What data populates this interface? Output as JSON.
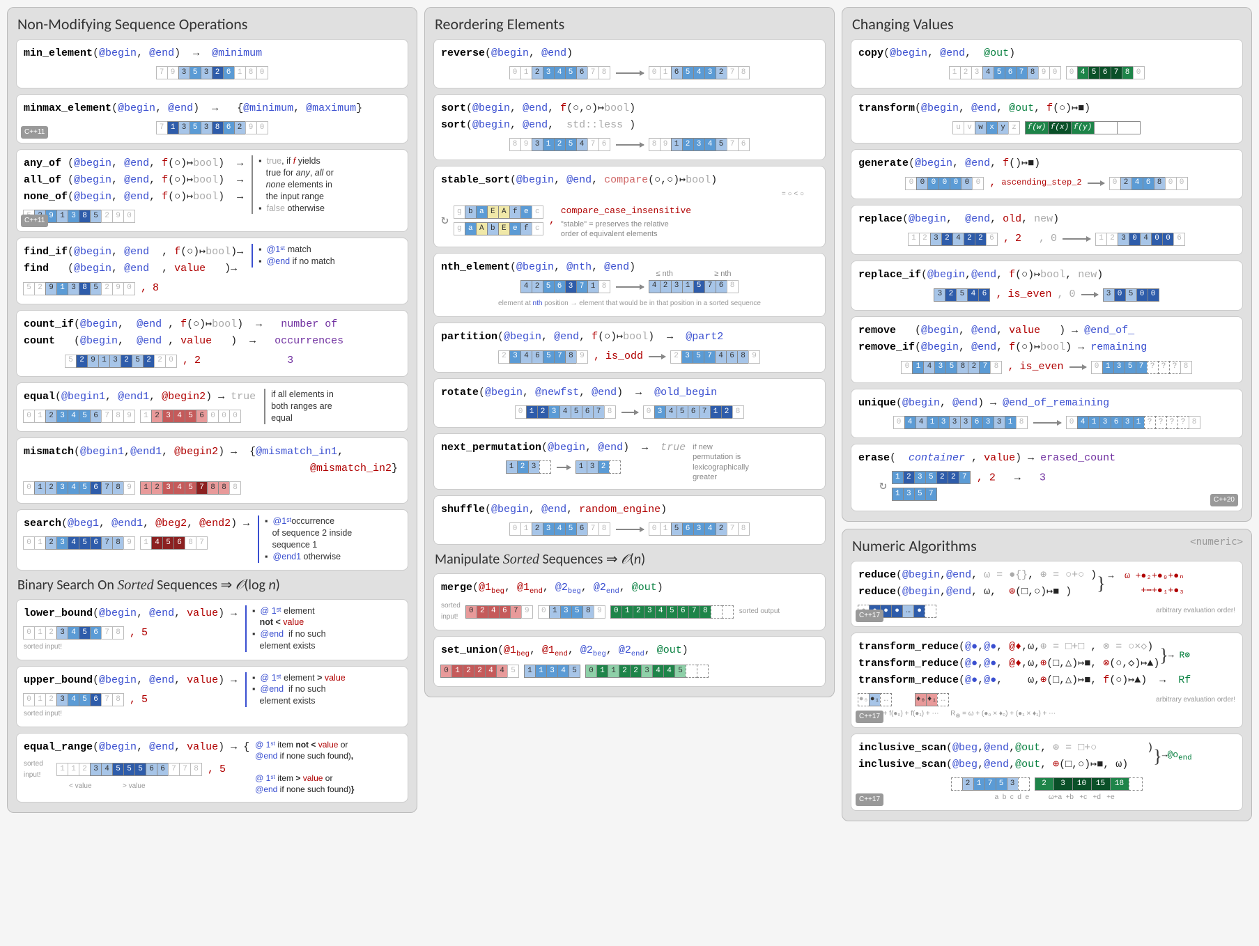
{
  "col1": {
    "title": "Non-Modifying Sequence Operations",
    "min_element": {
      "fn": "min_element",
      "sig": "(@begin, @end)  →  @minimum",
      "seq": [
        "7",
        "9",
        "3",
        "5",
        "3",
        "2",
        "6",
        "1",
        "8",
        "0"
      ]
    },
    "minmax_element": {
      "fn": "minmax_element",
      "sig": "(@begin, @end)  →",
      "ret": "{@minimum, @maximum}",
      "badge": "C++11",
      "seq": [
        "7",
        "1",
        "3",
        "5",
        "3",
        "8",
        "6",
        "2",
        "9",
        "0"
      ]
    },
    "any_all_none": {
      "lines": [
        {
          "fn": "any_of ",
          "sig": "(@begin, @end, f(○)↦bool)  →"
        },
        {
          "fn": "all_of ",
          "sig": "(@begin, @end, f(○)↦bool)  →"
        },
        {
          "fn": "none_of",
          "sig": "(@begin, @end, f(○)↦bool)  →"
        }
      ],
      "badge": "C++11",
      "desc": "▪  true, if f yields\n   true for any, all or\n   none elements in\n   the input range\n▪  false otherwise",
      "seq": [
        "5",
        "2",
        "9",
        "1",
        "3",
        "8",
        "5",
        "2",
        "9",
        "0"
      ]
    },
    "find": {
      "lines": [
        {
          "fn": "find_if",
          "sig": "(@begin, @end  , f(○)↦bool)→"
        },
        {
          "fn": "find   ",
          "sig": "(@begin, @end  , value   )→"
        }
      ],
      "desc": "▪  @1ˢᵗ match\n▪  @end if no match",
      "seq": [
        "5",
        "2",
        "9",
        "1",
        "3",
        "8",
        "5",
        "2",
        "9",
        "0"
      ],
      "val_ex": "8"
    },
    "count": {
      "lines": [
        {
          "fn": "count_if",
          "sig": "(@begin,  @end , f(○)↦bool)  →"
        },
        {
          "fn": "count   ",
          "sig": "(@begin,  @end , value   )  →"
        }
      ],
      "ret": "number of\noccurrences",
      "seq": [
        "5",
        "2",
        "9",
        "1",
        "3",
        "2",
        "5",
        "2",
        "2",
        "0"
      ],
      "val_ex": "2",
      "out_ex": "3"
    },
    "equal": {
      "fn": "equal",
      "sig": "(@begin1, @end1, @begin2) → true",
      "desc": "if all elements in\nboth ranges are\nequal",
      "seq1": [
        "0",
        "1",
        "2",
        "3",
        "4",
        "5",
        "6",
        "7",
        "8",
        "9"
      ],
      "seq2": [
        "1",
        "2",
        "3",
        "4",
        "5",
        "6",
        "0",
        "0",
        "0"
      ]
    },
    "mismatch": {
      "fn": "mismatch",
      "sig": "(@begin1,@end1, @begin2) →",
      "ret": "{@mismatch_in1,\n @mismatch_in2}",
      "seq1": [
        "0",
        "1",
        "2",
        "3",
        "4",
        "5",
        "6",
        "7",
        "8",
        "9"
      ],
      "seq2": [
        "1",
        "2",
        "3",
        "4",
        "5",
        "7",
        "8",
        "8",
        "8"
      ]
    },
    "search": {
      "fn": "search",
      "sig": "(@beg1, @end1, @beg2, @end2) →",
      "desc": "▪  @1ˢᵗoccurrence\n   of sequence 2 inside\n   sequence 1\n▪  @end1 otherwise",
      "seq1": [
        "0",
        "1",
        "2",
        "3",
        "4",
        "5",
        "6",
        "7",
        "8",
        "9"
      ],
      "seq2": [
        "1",
        "4",
        "5",
        "6",
        "8",
        "7"
      ]
    },
    "bsearch_title": "Binary Search On Sorted Sequences ⇒ 𝒪(log n)",
    "lower_bound": {
      "fn": "lower_bound",
      "sig": "(@begin, @end, value) →",
      "val_ex": "5",
      "desc": "▪  @ 1ˢᵗ element\n   not < value\n▪  @end  if no such\n   element exists",
      "seq": [
        "0",
        "1",
        "2",
        "3",
        "4",
        "5",
        "6",
        "7",
        "8"
      ],
      "note": "sorted input!"
    },
    "upper_bound": {
      "fn": "upper_bound",
      "sig": "(@begin, @end, value) →",
      "val_ex": "5",
      "desc": "▪  @ 1ˢᵗ element > value\n▪  @end  if no such\n   element exists",
      "seq": [
        "0",
        "1",
        "2",
        "3",
        "4",
        "5",
        "6",
        "7",
        "8"
      ],
      "note": "sorted input!"
    },
    "equal_range": {
      "fn": "equal_range",
      "sig": "(@begin, @end, value) → {",
      "val_ex": "5",
      "desc_top": "@ 1ˢᵗ item not < value or\n@end if none such found),",
      "desc_bot": "@ 1ˢᵗ item > value or\n@end if none such found)}",
      "seq": [
        "1",
        "1",
        "2",
        "3",
        "4",
        "5",
        "5",
        "5",
        "6",
        "6",
        "7",
        "7",
        "8"
      ],
      "note": "sorted\ninput!",
      "ann_l": "< value",
      "ann_r": "> value"
    }
  },
  "col2": {
    "title": "Reordering Elements",
    "reverse": {
      "fn": "reverse",
      "sig": "(@begin, @end)",
      "seq1": [
        "0",
        "1",
        "2",
        "3",
        "4",
        "5",
        "6",
        "7",
        "8"
      ],
      "seq2": [
        "0",
        "1",
        "6",
        "5",
        "4",
        "3",
        "2",
        "7",
        "8"
      ]
    },
    "sort": {
      "lines": [
        {
          "fn": "sort",
          "sig": "(@begin, @end, f(○,○)↦bool)"
        },
        {
          "fn": "sort",
          "sig": "(@begin, @end,  std::less )"
        }
      ],
      "seq1": [
        "8",
        "9",
        "3",
        "1",
        "2",
        "5",
        "4",
        "7",
        "6"
      ],
      "seq2": [
        "8",
        "9",
        "1",
        "2",
        "3",
        "4",
        "5",
        "7",
        "6"
      ]
    },
    "stable_sort": {
      "fn": "stable_sort",
      "sig": "(@begin, @end, compare(○,○)↦bool)",
      "ann": "= ○ < ○",
      "seq1": [
        "g",
        "b",
        "a",
        "E",
        "A",
        "f",
        "e",
        "c"
      ],
      "seq2": [
        "g",
        "a",
        "A",
        "b",
        "E",
        "e",
        "f",
        "c"
      ],
      "pred_ex": "compare_case_insensitive",
      "note": "\"stable\" = preserves the relative\norder of equivalent elements"
    },
    "nth_element": {
      "fn": "nth_element",
      "sig": "(@begin, @nth, @end)",
      "ann_l": "≤ nth",
      "ann_r": "≥ nth",
      "seq1": [
        "4",
        "2",
        "5",
        "6",
        "3",
        "7",
        "1",
        "8"
      ],
      "seq2": [
        "4",
        "2",
        "3",
        "1",
        "5",
        "7",
        "6",
        "8"
      ],
      "note": "element at nth position → element that would be in that position in a sorted sequence"
    },
    "partition": {
      "fn": "partition",
      "sig": "(@begin, @end, f(○)↦bool)  →  @part2",
      "pred_ex": "is_odd",
      "seq1": [
        "2",
        "3",
        "4",
        "6",
        "5",
        "7",
        "8",
        "9"
      ],
      "seq2": [
        "2",
        "3",
        "5",
        "7",
        "4",
        "6",
        "8",
        "9"
      ]
    },
    "rotate": {
      "fn": "rotate",
      "sig": "(@begin, @newfst, @end)  →  @old_begin",
      "seq1": [
        "0",
        "1",
        "2",
        "3",
        "4",
        "5",
        "6",
        "7",
        "8"
      ],
      "seq2": [
        "0",
        "3",
        "4",
        "5",
        "6",
        "7",
        "1",
        "2",
        "8"
      ]
    },
    "next_permutation": {
      "fn": "next_permutation",
      "sig": "(@begin, @end)  →  true",
      "desc": "if new\npermutation is\nlexicographically\ngreater",
      "seq1": [
        "1",
        "2",
        "3"
      ],
      "seq2": [
        "1",
        "3",
        "2"
      ]
    },
    "shuffle": {
      "fn": "shuffle",
      "sig": "(@begin, @end, random_engine)",
      "seq1": [
        "0",
        "1",
        "2",
        "3",
        "4",
        "5",
        "6",
        "7",
        "8"
      ],
      "seq2": [
        "0",
        "1",
        "5",
        "6",
        "3",
        "4",
        "2",
        "7",
        "8"
      ]
    },
    "sorted_title": "Manipulate Sorted Sequences ⇒ 𝒪(n)",
    "merge": {
      "fn": "merge",
      "sig": "(@1beg, @1end, @2beg, @2end, @out)",
      "note_l": "sorted\ninput!",
      "note_r": "sorted output",
      "seq1": [
        "0",
        "2",
        "4",
        "6",
        "7",
        "9"
      ],
      "seq2": [
        "0",
        "1",
        "3",
        "5",
        "8",
        "9"
      ],
      "seq3": [
        "0",
        "1",
        "2",
        "3",
        "4",
        "5",
        "6",
        "7",
        "8",
        " ",
        " "
      ]
    },
    "set_union": {
      "fn": "set_union",
      "sig": "(@1beg, @1end, @2beg, @2end, @out)",
      "seq1": [
        "0",
        "1",
        "2",
        "2",
        "4",
        "4",
        "5"
      ],
      "seq2": [
        "1",
        "1",
        "3",
        "4",
        "5"
      ],
      "seq3": [
        "0",
        "1",
        "1",
        "2",
        "2",
        "3",
        "4",
        "4",
        "5",
        " ",
        " "
      ]
    }
  },
  "col3": {
    "title": "Changing Values",
    "copy": {
      "fn": "copy",
      "sig": "(@begin, @end,  @out)",
      "seq1": [
        "1",
        "2",
        "3",
        "4",
        "5",
        "6",
        "7",
        "8",
        "9",
        "0"
      ],
      "seq2": [
        "0",
        "4",
        "5",
        "6",
        "7",
        "8",
        "0"
      ]
    },
    "transform": {
      "fn": "transform",
      "sig": "(@begin, @end, @out, f(○)↦■)",
      "seq1": [
        "u",
        "v",
        "w",
        "x",
        "y",
        "z"
      ],
      "seq2": [
        "f(w)",
        "f(x)",
        "f(y)",
        " ",
        " "
      ]
    },
    "generate": {
      "fn": "generate",
      "sig": "(@begin, @end, f()↦■)",
      "pred_ex": "ascending_step_2",
      "seq1": [
        "0",
        "0",
        "0",
        "0",
        "0",
        "0",
        "0"
      ],
      "seq2": [
        "0",
        "2",
        "4",
        "6",
        "8",
        "0",
        "0"
      ]
    },
    "replace": {
      "fn": "replace",
      "sig": "(@begin,  @end, old, new)",
      "old_ex": "2",
      "new_ex": "0",
      "seq1": [
        "1",
        "2",
        "3",
        "2",
        "4",
        "2",
        "2",
        "6"
      ],
      "seq2": [
        "1",
        "2",
        "3",
        "0",
        "4",
        "0",
        "0",
        "6"
      ]
    },
    "replace_if": {
      "fn": "replace_if",
      "sig": "(@begin,@end, f(○)↦bool, new)",
      "pred_ex": "is_even",
      "new_ex": "0",
      "seq1": [
        "3",
        "2",
        "5",
        "4",
        "6"
      ],
      "seq2": [
        "3",
        "0",
        "5",
        "0",
        "0"
      ]
    },
    "remove": {
      "lines": [
        {
          "fn": "remove   ",
          "sig": "(@begin, @end, value   ) → @end_of_"
        },
        {
          "fn": "remove_if",
          "sig": "(@begin, @end, f(○)↦bool) → remaining"
        }
      ],
      "pred_ex": "is_even",
      "seq1": [
        "0",
        "1",
        "4",
        "3",
        "5",
        "8",
        "2",
        "7",
        "8"
      ],
      "seq2": [
        "0",
        "1",
        "3",
        "5",
        "7",
        "?",
        "?",
        "?",
        "8"
      ]
    },
    "unique": {
      "fn": "unique",
      "sig": "(@begin, @end) → @end_of_remaining",
      "seq1": [
        "0",
        "4",
        "4",
        "1",
        "3",
        "3",
        "3",
        "6",
        "3",
        "3",
        "1",
        "8"
      ],
      "seq2": [
        "0",
        "4",
        "1",
        "3",
        "6",
        "3",
        "1",
        "?",
        "?",
        "?",
        "?",
        "8"
      ]
    },
    "erase": {
      "fn": "erase",
      "sig": "(  container , value) → erased_count",
      "val_ex": "2",
      "out_ex": "3",
      "badge": "C++20",
      "seq1": [
        "1",
        "2",
        "3",
        "5",
        "2",
        "2",
        "7"
      ],
      "seq2": [
        "1",
        "3",
        "5",
        "7"
      ]
    },
    "numeric_title": "Numeric Algorithms",
    "numeric_header": "<numeric>",
    "reduce": {
      "lines": [
        {
          "fn": "reduce",
          "sig": "(@begin,@end, ω = ●{}, ⊕ = ○+○ )"
        },
        {
          "fn": "reduce",
          "sig": "(@begin,@end, ω,  ⊕(□,○)↦■ )"
        }
      ],
      "ret": "ω +●₂+●₀+●ₙ\n+⋯+●₁+●₃",
      "note": "arbitrary evaluation order!",
      "badge": "C++17",
      "seq": [
        "●",
        "●",
        "●",
        "●",
        "…",
        "●"
      ]
    },
    "transform_reduce": {
      "lines": [
        {
          "fn": "transform_reduce",
          "sig": "(@●,@●, @♦,ω,⊕ = □+□ , ⊗ = ○×◇)"
        },
        {
          "fn": "transform_reduce",
          "sig": "(@●,@●, @♦,ω,⊕(□,△)↦■, ⊗(○,◇)↦▲)"
        },
        {
          "fn": "transform_reduce",
          "sig": "(@●,@●,    ω,⊕(□,△)↦■, f(○)↦▲)  →  Rf"
        }
      ],
      "ret": "R⊗",
      "badge": "C++17",
      "note": "arbitrary evaluation order!",
      "seq1": [
        "●₀",
        "●₁",
        "…"
      ],
      "seq2": [
        "♦₀",
        "♦₁",
        "…"
      ],
      "formula_l": "Rf = ω + f(●₀) + f(●₁) + ⋯",
      "formula_r": "R⊗ = ω + (●₀ × ♦₀) + (●₁ × ♦₁) + ⋯"
    },
    "inclusive_scan": {
      "lines": [
        {
          "fn": "inclusive_scan",
          "sig": "(@beg,@end,@out, ⊕ = □+○        )"
        },
        {
          "fn": "inclusive_scan",
          "sig": "(@beg,@end,@out, ⊕(□,○)↦■, ω)"
        }
      ],
      "ret": "@oend",
      "badge": "C++17",
      "seq1": [
        "2",
        "1",
        "7",
        "5",
        "3"
      ],
      "seq2": [
        "2",
        "3",
        "10",
        "15",
        "18"
      ],
      "ann": [
        "ω+a",
        "+b",
        "+c",
        "+d",
        "+e"
      ],
      "inp_lbl": [
        "a",
        "b",
        "c",
        "d",
        "e"
      ]
    }
  }
}
